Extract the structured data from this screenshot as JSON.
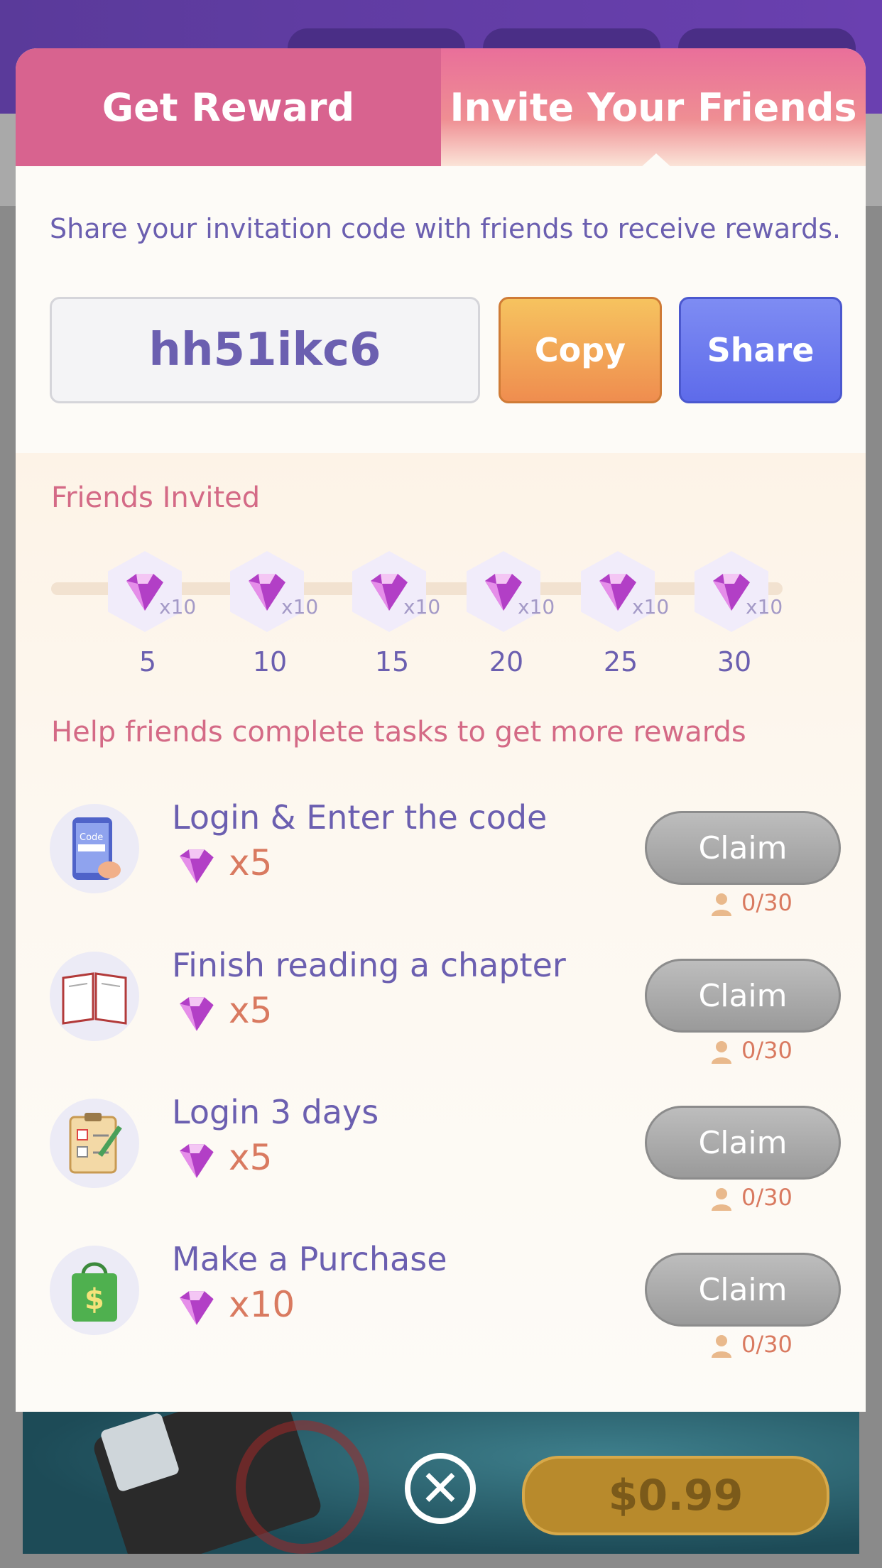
{
  "tabs": [
    {
      "label": "Get Reward"
    },
    {
      "label": "Invite Your Friends"
    }
  ],
  "invite": {
    "description": "Share your invitation code with friends to receive rewards.",
    "code": "hh51ikc6",
    "copy_label": "Copy",
    "share_label": "Share"
  },
  "friends_invited": {
    "title": "Friends Invited",
    "milestones": [
      {
        "count": "5",
        "reward": "x10"
      },
      {
        "count": "10",
        "reward": "x10"
      },
      {
        "count": "15",
        "reward": "x10"
      },
      {
        "count": "20",
        "reward": "x10"
      },
      {
        "count": "25",
        "reward": "x10"
      },
      {
        "count": "30",
        "reward": "x10"
      }
    ]
  },
  "tasks_section": {
    "title": "Help friends complete tasks to get more rewards",
    "tasks": [
      {
        "title": "Login & Enter the code",
        "reward": "x5",
        "claim_label": "Claim",
        "progress": "0/30",
        "icon": "phone-code-icon"
      },
      {
        "title": "Finish reading a chapter",
        "reward": "x5",
        "claim_label": "Claim",
        "progress": "0/30",
        "icon": "open-book-icon"
      },
      {
        "title": "Login 3 days",
        "reward": "x5",
        "claim_label": "Claim",
        "progress": "0/30",
        "icon": "checklist-icon"
      },
      {
        "title": "Make a Purchase",
        "reward": "x10",
        "claim_label": "Claim",
        "progress": "0/30",
        "icon": "shopping-bag-icon"
      }
    ]
  },
  "background": {
    "price_label": "$0.99"
  },
  "icons": {
    "close": "close-icon",
    "gem": "gem-icon",
    "person": "person-icon"
  },
  "colors": {
    "tab_pink": "#d8638f",
    "accent_purple": "#6b5fb0",
    "section_pink": "#d46a86",
    "copy_orange": "#ef8d4f",
    "share_blue": "#5e6bea",
    "claim_gray": "#9a9a9a"
  }
}
